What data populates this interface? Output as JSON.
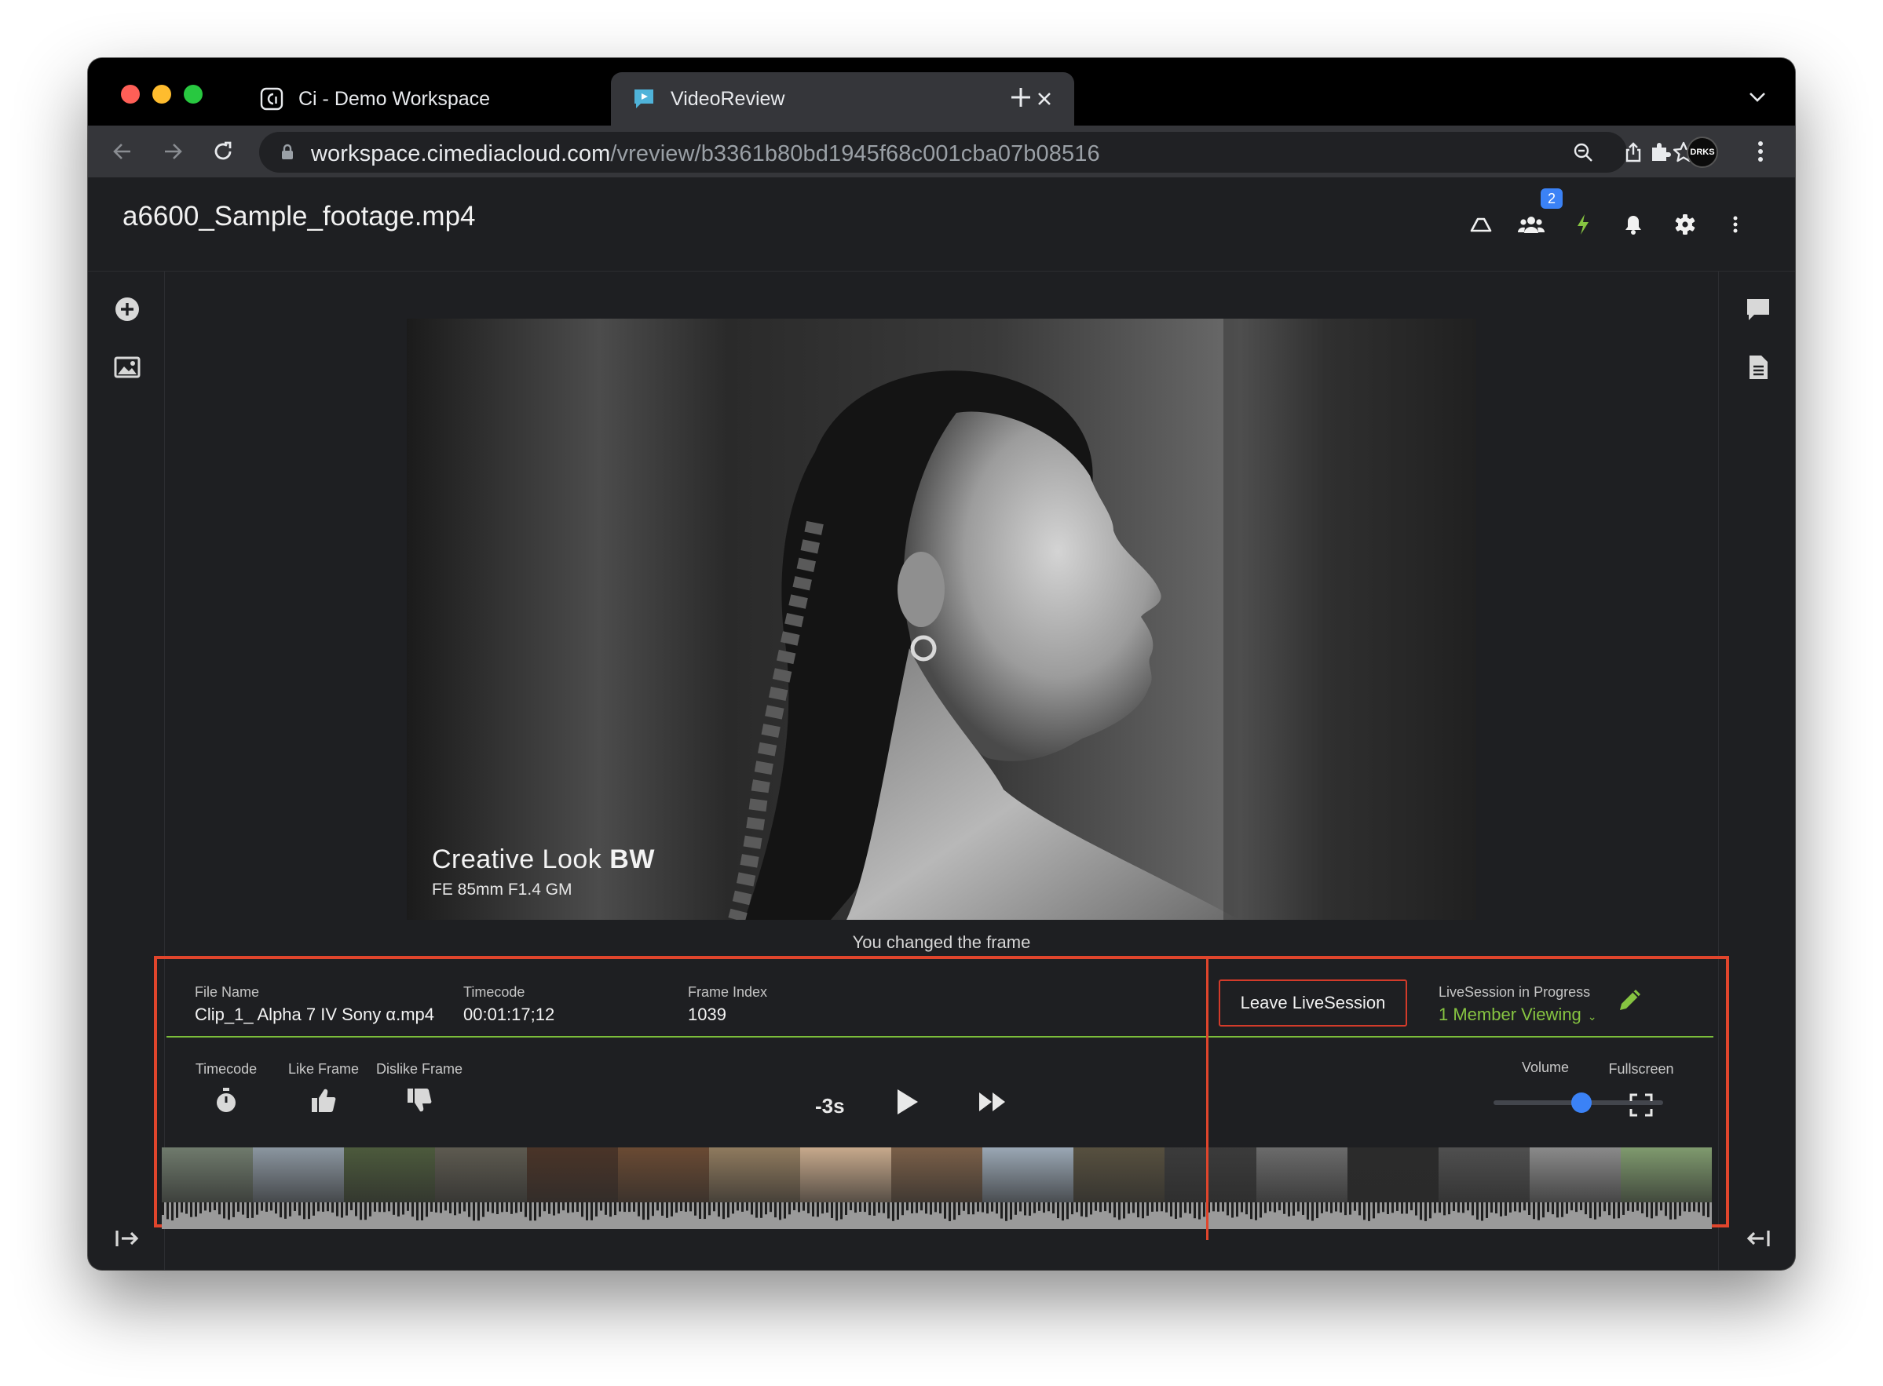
{
  "browser": {
    "tabs": [
      {
        "title": "Ci - Demo Workspace",
        "favicon": "ci-logo-icon",
        "active": false
      },
      {
        "title": "VideoReview",
        "favicon": "video-review-icon",
        "active": true
      }
    ],
    "url_host": "workspace.cimediacloud.com",
    "url_path": "/vreview/b3361b80bd1945f68c001cba07b08516",
    "profile_label": "DRKS"
  },
  "app": {
    "file_title": "a6600_Sample_footage.mp4",
    "members_badge": "2",
    "accent_color": "#86c441",
    "alert_color": "#e0452c"
  },
  "video": {
    "overlay_title": "Creative Look",
    "overlay_title_bold": "BW",
    "overlay_subtitle": "FE 85mm F1.4 GM",
    "notice": "You changed the frame"
  },
  "session": {
    "file_name_label": "File Name",
    "file_name": "Clip_1_ Alpha 7 IV Sony α.mp4",
    "timecode_label": "Timecode",
    "timecode": "00:01:17;12",
    "frame_index_label": "Frame Index",
    "frame_index": "1039",
    "leave_button": "Leave LiveSession",
    "status_label": "LiveSession in Progress",
    "status_value": "1 Member Viewing"
  },
  "controls": {
    "timecode_label": "Timecode",
    "like_label": "Like Frame",
    "dislike_label": "Dislike Frame",
    "skip_back": "-3s",
    "volume_label": "Volume",
    "volume_level": 0.52,
    "fullscreen_label": "Fullscreen",
    "playhead_position": 0.674
  },
  "filmstrip_colors": [
    "#6f7a6c",
    "#8b96a0",
    "#4c5a3c",
    "#5d5a50",
    "#4a3428",
    "#6a4a33",
    "#8f7a5e",
    "#c7a98c",
    "#7a5f48",
    "#9aa7b4",
    "#57503f",
    "#3b3b3b",
    "#6b6b6b",
    "#2b2b2b",
    "#4f4f4f",
    "#8a8a8a",
    "#7f9a6e"
  ]
}
